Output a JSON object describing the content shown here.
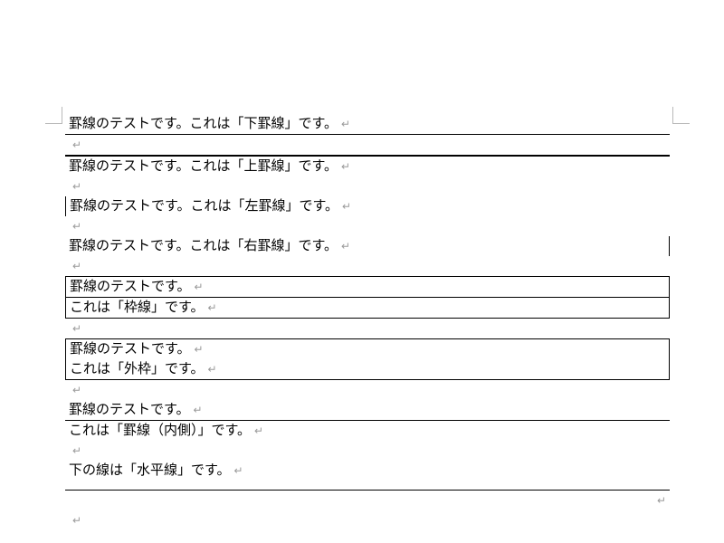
{
  "symbols": {
    "return": "↵"
  },
  "lines": {
    "bottom": "罫線のテストです。これは「下罫線」です。",
    "top": "罫線のテストです。これは「上罫線」です。",
    "left": "罫線のテストです。これは「左罫線」です。",
    "right": "罫線のテストです。これは「右罫線」です。",
    "box1": "罫線のテストです。",
    "box2": "これは「枠線」です。",
    "outer1": "罫線のテストです。",
    "outer2": "これは「外枠」です。",
    "inside1": "罫線のテストです。",
    "inside2": "これは「罫線（内側）」です。",
    "hr_label": "下の線は「水平線」です。"
  }
}
